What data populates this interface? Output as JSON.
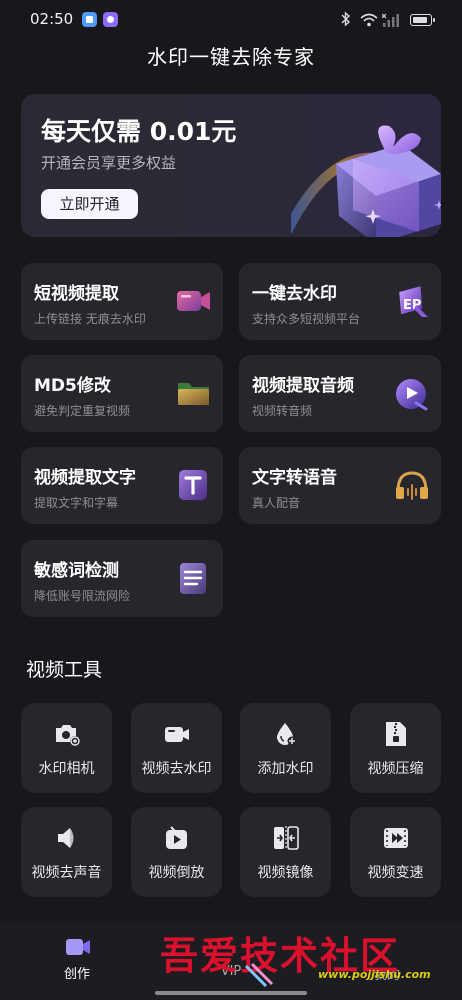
{
  "status_bar": {
    "time": "02:50",
    "notif_icons": [
      "app-notification-icon-blue",
      "app-notification-icon-purple"
    ]
  },
  "app_title": "水印一键去除专家",
  "banner": {
    "title": "每天仅需 0.01元",
    "subtitle": "开通会员享更多权益",
    "button_label": "立即开通"
  },
  "features": [
    {
      "title": "短视频提取",
      "subtitle": "上传链接 无痕去水印",
      "icon": "video-camera-icon"
    },
    {
      "title": "一键去水印",
      "subtitle": "支持众多短视频平台",
      "icon": "eraser-icon"
    },
    {
      "title": "MD5修改",
      "subtitle": "避免判定重复视频",
      "icon": "folder-icon"
    },
    {
      "title": "视频提取音频",
      "subtitle": "视频转音频",
      "icon": "music-note-icon"
    },
    {
      "title": "视频提取文字",
      "subtitle": "提取文字和字幕",
      "icon": "text-t-icon"
    },
    {
      "title": "文字转语音",
      "subtitle": "真人配音",
      "icon": "headphones-icon"
    },
    {
      "title": "敏感词检测",
      "subtitle": "降低账号限流网险",
      "icon": "document-lines-icon"
    }
  ],
  "tools_section": {
    "title": "视频工具",
    "items": [
      {
        "label": "水印相机",
        "icon": "camera-plus-icon"
      },
      {
        "label": "视频去水印",
        "icon": "video-icon"
      },
      {
        "label": "添加水印",
        "icon": "droplet-icon"
      },
      {
        "label": "视频压缩",
        "icon": "zip-file-icon"
      },
      {
        "label": "视频去声音",
        "icon": "speaker-mute-icon"
      },
      {
        "label": "视频倒放",
        "icon": "rewind-play-icon"
      },
      {
        "label": "视频镜像",
        "icon": "mirror-icon"
      },
      {
        "label": "视频变速",
        "icon": "film-speed-icon"
      }
    ]
  },
  "bottom_nav": {
    "items": [
      {
        "label": "创作",
        "active": true
      },
      {
        "label": "VIP",
        "active": false
      },
      {
        "label": "我的",
        "active": false
      }
    ]
  },
  "watermark": {
    "text": "吾爱技术社区",
    "url": "www.pojjishu.com"
  },
  "colors": {
    "background": "#17171c",
    "card": "#26262c",
    "accent": "#7a6cf0",
    "watermark_red": "#d9112c"
  }
}
